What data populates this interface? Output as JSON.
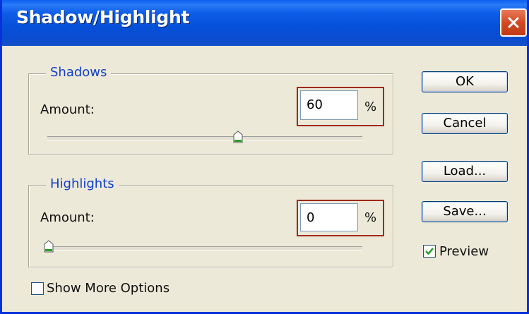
{
  "window": {
    "title": "Shadow/Highlight"
  },
  "shadows": {
    "legend": "Shadows",
    "amount_label": "Amount:",
    "amount_value": "60",
    "unit": "%",
    "slider_percent": 60
  },
  "highlights": {
    "legend": "Highlights",
    "amount_label": "Amount:",
    "amount_value": "0",
    "unit": "%",
    "slider_percent": 0
  },
  "buttons": {
    "ok": "OK",
    "cancel": "Cancel",
    "load": "Load...",
    "save": "Save..."
  },
  "preview": {
    "label": "Preview",
    "checked": true
  },
  "more_options": {
    "label": "Show More Options",
    "checked": false
  },
  "colors": {
    "titlebar": "#0650d8",
    "legend_text": "#1440c8",
    "field_highlight_border": "#a02a1a",
    "close_button": "#d24a24"
  },
  "icons": {
    "close": "close-icon",
    "slider_thumb": "slider-thumb-icon",
    "checkmark": "checkmark-icon"
  }
}
